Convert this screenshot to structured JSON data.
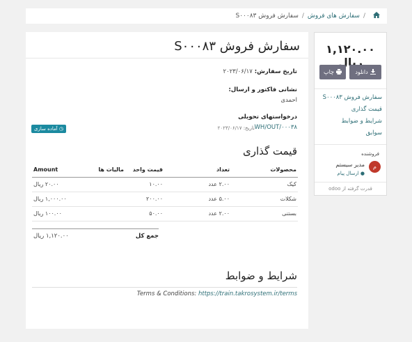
{
  "breadcrumb": {
    "home_icon": "home-icon",
    "sep1": "/",
    "sales_orders": "سفارش های فروش",
    "sep2": "/",
    "current": "سفارش فروش S۰۰۰۸۳"
  },
  "document": {
    "title": "سفارش فروش S۰۰۰۸۳",
    "order_date_label": "تاریخ سفارش:",
    "order_date": "۲۰۲۳/۰۶/۱۷",
    "address_label": "نشانی فاکتور و ارسال:",
    "address_name": "احمدی",
    "delivery_label": "درخواستهای تحویلی",
    "delivery_ref": "WH/OUT/۰۰۰۳۸",
    "delivery_date_label": "تاریخ:",
    "delivery_date": "۲۰۲۳/۰۶/۱۷",
    "status_badge": "آماده سازی",
    "pricing_title": "قیمت گذاری",
    "table": {
      "headers": {
        "product": "محصولات",
        "qty": "تعداد",
        "unit_price": "قیمت واحد",
        "taxes": "مالیات ها",
        "amount": "Amount"
      },
      "rows": [
        {
          "product": "کیک",
          "qty": "۲.۰۰ عدد",
          "unit_price": "۱۰.۰۰",
          "taxes": "",
          "amount": "۲۰.۰۰ ریال"
        },
        {
          "product": "شکلات",
          "qty": "۵.۰۰ عدد",
          "unit_price": "۲۰۰.۰۰",
          "taxes": "",
          "amount": "۱,۰۰۰.۰۰ ریال"
        },
        {
          "product": "بستنی",
          "qty": "۲.۰۰ عدد",
          "unit_price": "۵۰.۰۰",
          "taxes": "",
          "amount": "۱۰۰.۰۰ ریال"
        }
      ]
    },
    "total_label": "جمع کل",
    "total_value": "۱,۱۲۰.۰۰ ریال",
    "terms_title": "شرایط و ضوابط",
    "terms_prefix": "Terms & Conditions:",
    "terms_link": "https://train.takrosystem.ir/terms"
  },
  "sidebar": {
    "total": "۱,۱۲۰.۰۰ ریال",
    "download_label": "دانلود",
    "print_label": "چاپ",
    "nav": [
      "سفارش فروش S۰۰۰۸۳",
      "قیمت گذاری",
      "شرایط و ضوابط",
      "سوابق"
    ],
    "seller_label": "فروشنده",
    "seller_initial": "م",
    "seller_name": "مدیر سیستم",
    "send_message": "ارسال پیام",
    "powered_by": "قدرت گرفته از",
    "odoo": "odoo"
  },
  "colors": {
    "accent": "#2d6e76",
    "button": "#6f6f80",
    "badge": "#1b8aa0",
    "avatar": "#c0392b"
  }
}
